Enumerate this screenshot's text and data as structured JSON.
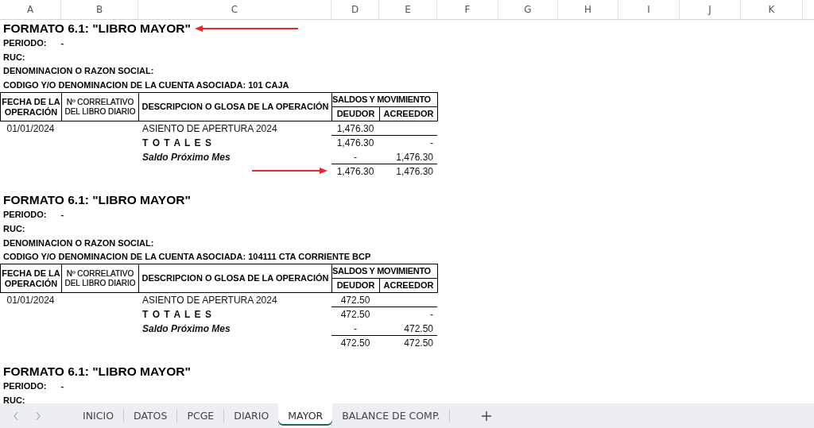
{
  "columns": [
    "A",
    "B",
    "C",
    "D",
    "E",
    "F",
    "G",
    "H",
    "I",
    "J",
    "K"
  ],
  "blocks": [
    {
      "title": "FORMATO 6.1: \"LIBRO MAYOR\"",
      "title_arrow": true,
      "periodo_label": "PERIODO:",
      "periodo_value": "-",
      "ruc_label": "RUC:",
      "razon_label": "DENOMINACION O RAZON SOCIAL:",
      "cuenta_label": "CODIGO Y/O DENOMINACION DE LA CUENTA ASOCIADA: 101 CAJA",
      "table": {
        "headers": {
          "fecha": "FECHA DE LA OPERACIÓN",
          "correlativo": "Nº CORRELATIVO DEL LIBRO DIARIO",
          "descripcion": "DESCRIPCION O GLOSA DE LA OPERACIÓN",
          "saldos": "SALDOS Y MOVIMIENTO",
          "deudor": "DEUDOR",
          "acreedor": "ACREEDOR"
        },
        "rows": [
          {
            "kind": "entry",
            "date": "01/01/2024",
            "description": "ASIENTO DE APERTURA 2024",
            "debit": "1,476.30"
          },
          {
            "kind": "totals",
            "description": "T O T A L E S",
            "debit": "1,476.30",
            "credit": "-"
          },
          {
            "kind": "saldo",
            "description": "Saldo Próximo Mes",
            "debit": "-",
            "credit": "1,476.30"
          },
          {
            "kind": "final",
            "debit": "1,476.30",
            "credit": "1,476.30",
            "arrow": true
          }
        ]
      }
    },
    {
      "title": "FORMATO 6.1: \"LIBRO MAYOR\"",
      "title_arrow": false,
      "periodo_label": "PERIODO:",
      "periodo_value": "-",
      "ruc_label": "RUC:",
      "razon_label": "DENOMINACION O RAZON SOCIAL:",
      "cuenta_label": "CODIGO Y/O DENOMINACION DE LA CUENTA ASOCIADA: 104111 CTA CORRIENTE BCP",
      "table": {
        "headers": {
          "fecha": "FECHA DE LA OPERACIÓN",
          "correlativo": "Nº CORRELATIVO DEL LIBRO DIARIO",
          "descripcion": "DESCRIPCION O GLOSA DE LA OPERACIÓN",
          "saldos": "SALDOS Y MOVIMIENTO",
          "deudor": "DEUDOR",
          "acreedor": "ACREEDOR"
        },
        "rows": [
          {
            "kind": "entry",
            "date": "01/01/2024",
            "description": "ASIENTO DE APERTURA 2024",
            "debit": "472.50"
          },
          {
            "kind": "totals",
            "description": "T O T A L E S",
            "debit": "472.50",
            "credit": "-"
          },
          {
            "kind": "saldo",
            "description": "Saldo Próximo Mes",
            "debit": "-",
            "credit": "472.50"
          },
          {
            "kind": "final",
            "debit": "472.50",
            "credit": "472.50",
            "arrow": false
          }
        ]
      }
    },
    {
      "title": "FORMATO 6.1: \"LIBRO MAYOR\"",
      "title_arrow": false,
      "periodo_label": "PERIODO:",
      "periodo_value": "-",
      "ruc_label": "RUC:"
    }
  ],
  "sheet_tabs": [
    {
      "label": "INICIO",
      "selected": false
    },
    {
      "label": "DATOS",
      "selected": false
    },
    {
      "label": "PCGE",
      "selected": false
    },
    {
      "label": "DIARIO",
      "selected": false
    },
    {
      "label": "MAYOR",
      "selected": true
    },
    {
      "label": "BALANCE DE COMP.",
      "selected": false
    }
  ]
}
